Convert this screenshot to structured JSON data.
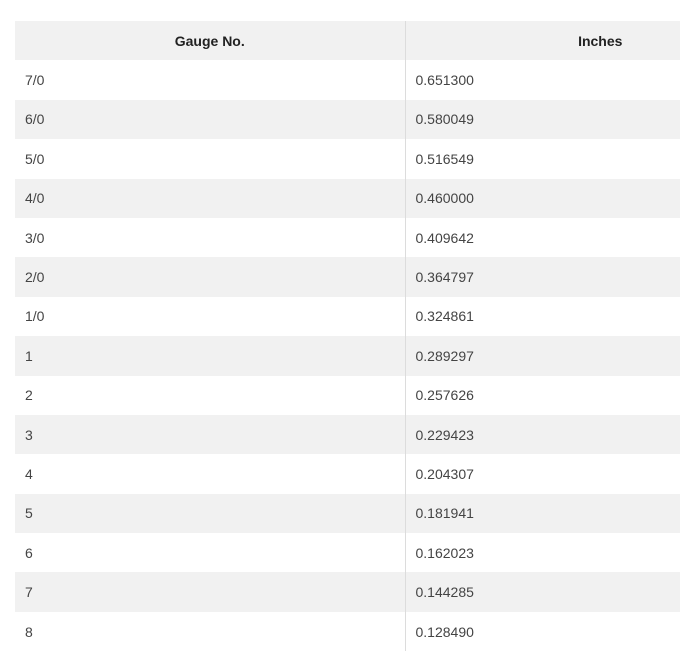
{
  "table": {
    "headers": [
      "Gauge No.",
      "Inches"
    ],
    "rows": [
      [
        "7/0",
        "0.651300"
      ],
      [
        "6/0",
        "0.580049"
      ],
      [
        "5/0",
        "0.516549"
      ],
      [
        "4/0",
        "0.460000"
      ],
      [
        "3/0",
        "0.409642"
      ],
      [
        "2/0",
        "0.364797"
      ],
      [
        "1/0",
        "0.324861"
      ],
      [
        "1",
        "0.289297"
      ],
      [
        "2",
        "0.257626"
      ],
      [
        "3",
        "0.229423"
      ],
      [
        "4",
        "0.204307"
      ],
      [
        "5",
        "0.181941"
      ],
      [
        "6",
        "0.162023"
      ],
      [
        "7",
        "0.144285"
      ],
      [
        "8",
        "0.128490"
      ]
    ]
  }
}
